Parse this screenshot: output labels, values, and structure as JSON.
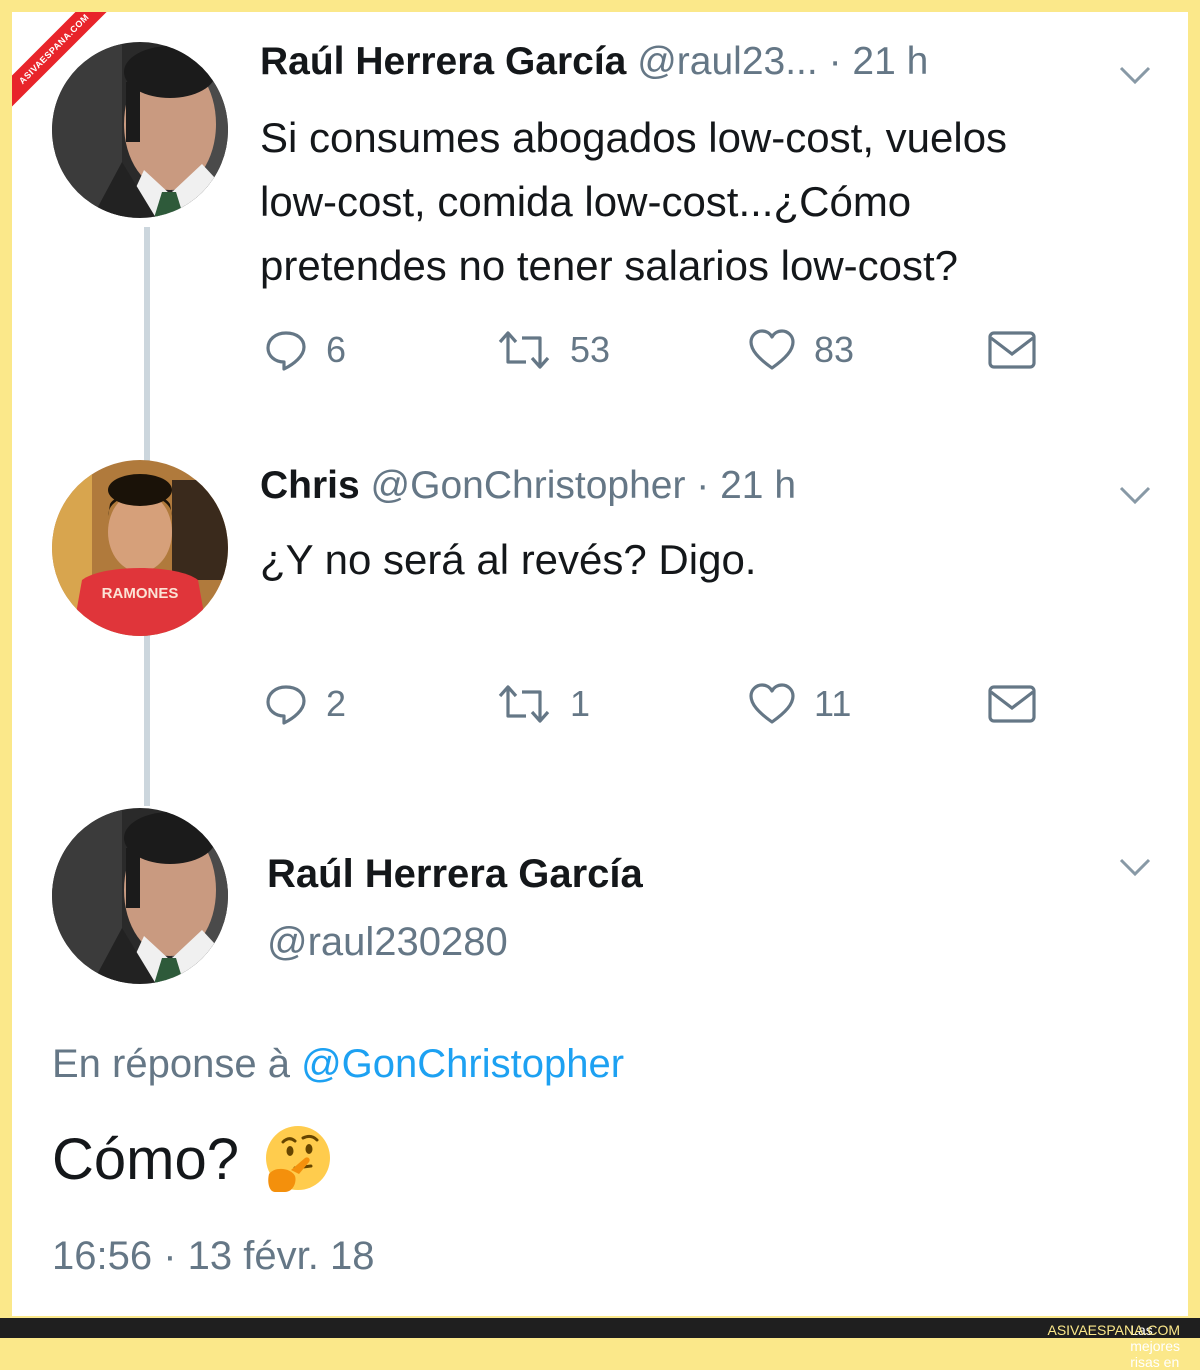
{
  "watermark": {
    "text": "ASIVAESPANA.COM"
  },
  "tweets": [
    {
      "name": "Raúl Herrera García",
      "handle": "@raul23...",
      "time": "· 21 h",
      "avatar_icon": "man-in-suit-avatar",
      "text_lines": [
        "Si consumes abogados low-cost, vuelos",
        "low-cost, comida low-cost...¿Cómo",
        "pretendes no tener salarios low-cost?"
      ],
      "replies": "6",
      "retweets": "53",
      "likes": "83"
    },
    {
      "name": "Chris",
      "handle": "@GonChristopher",
      "time": "· 21 h",
      "avatar_icon": "man-in-red-shirt-avatar",
      "shirt_text": "RAMONES",
      "text_lines": [
        "¿Y no será al revés? Digo."
      ],
      "replies": "2",
      "retweets": "1",
      "likes": "11"
    }
  ],
  "main_tweet": {
    "name": "Raúl Herrera García",
    "handle": "@raul230280",
    "reply_prefix": "En réponse à",
    "reply_mention": "@GonChristopher",
    "text": "Cómo?",
    "emoji": "thinking-face",
    "timestamp": "16:56 · 13 févr. 18"
  },
  "footer": {
    "prefix": "Las mejores risas en",
    "brand": "ASIVAESPANA.COM"
  },
  "colors": {
    "border": "#fbe88a",
    "text": "#14171a",
    "secondary": "#657786",
    "link": "#1da1f2",
    "thread_line": "#ccd6dd"
  }
}
